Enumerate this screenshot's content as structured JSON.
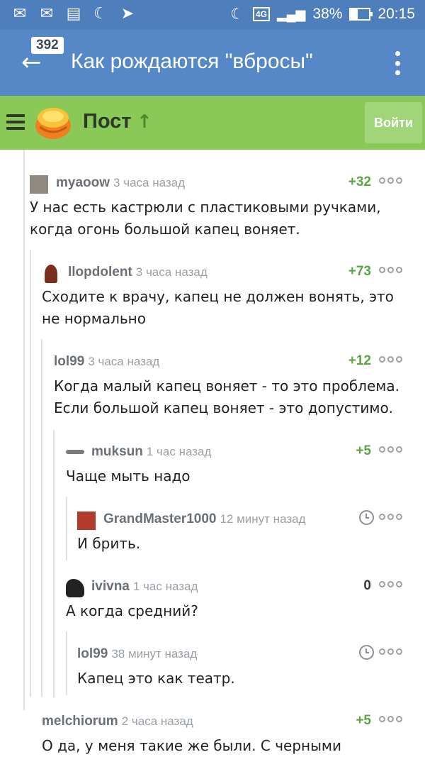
{
  "status_bar": {
    "network": "4G",
    "battery": "38%",
    "time": "20:15"
  },
  "app_bar": {
    "count_badge": "392",
    "title": "Как рождаются \"вбросы\""
  },
  "section_bar": {
    "label": "Пост",
    "login_label": "Войти"
  },
  "comments": [
    {
      "user": "myaoow",
      "time": "3 часа назад",
      "rating": "+32",
      "text": "У нас есть кастрюли с пластиковыми ручками, когда огонь большой капец воняет."
    },
    {
      "user": "llopdolent",
      "time": "3 часа назад",
      "rating": "+73",
      "text": "Сходите к врачу, капец не должен вонять, это не нормально"
    },
    {
      "user": "lol99",
      "time": "3 часа назад",
      "rating": "+12",
      "text": "Когда малый капец воняет - то это проблема. Если большой капец воняет - это допустимо."
    },
    {
      "user": "muksun",
      "time": "1 час назад",
      "rating": "+5",
      "text": "Чаще мыть надо"
    },
    {
      "user": "GrandMaster1000",
      "time": "12 минут назад",
      "rating": "",
      "text": "И брить."
    },
    {
      "user": "ivivna",
      "time": "1 час назад",
      "rating": "0",
      "text": "А когда средний?"
    },
    {
      "user": "lol99",
      "time": "38 минут назад",
      "rating": "",
      "text": "Капец это как театр."
    },
    {
      "user": "melchiorum",
      "time": "2 часа назад",
      "rating": "+5",
      "text": "О да, у меня такие же были. С черными"
    }
  ],
  "colors": {
    "status_bar": "#4f7ebc",
    "app_bar": "#5688c8",
    "green_bar": "#8ac858",
    "rating_positive": "#5aa646"
  }
}
